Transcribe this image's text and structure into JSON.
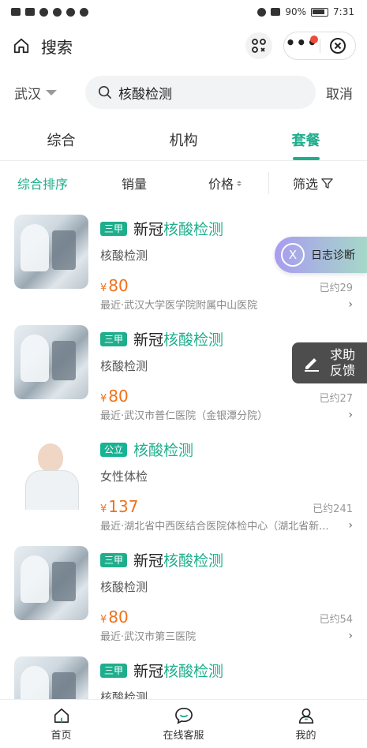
{
  "status_bar": {
    "battery": "90%",
    "time": "7:31"
  },
  "header": {
    "title": "搜索"
  },
  "search": {
    "city": "武汉",
    "query": "核酸检测",
    "cancel": "取消"
  },
  "tabs": [
    {
      "label": "综合",
      "active": false
    },
    {
      "label": "机构",
      "active": false
    },
    {
      "label": "套餐",
      "active": true
    }
  ],
  "filters": {
    "sort": "综合排序",
    "sales": "销量",
    "price": "价格",
    "filter": "筛选"
  },
  "items": [
    {
      "badge": "三甲",
      "title_prefix": "新冠",
      "title_hl": "核酸检测",
      "subtitle": "核酸检测",
      "yen": "¥",
      "price": "80",
      "sold": "已约29",
      "hospital": "最近·武汉大学医学院附属中山医院",
      "image": "lab"
    },
    {
      "badge": "三甲",
      "title_prefix": "新冠",
      "title_hl": "核酸检测",
      "subtitle": "核酸检测",
      "yen": "¥",
      "price": "80",
      "sold": "已约27",
      "hospital": "最近·武汉市普仁医院（金银潭分院）",
      "image": "lab"
    },
    {
      "badge": "公立",
      "title_prefix": "",
      "title_hl": "核酸检测",
      "subtitle": "女性体检",
      "yen": "¥",
      "price": "137",
      "sold": "已约241",
      "hospital": "最近·湖北省中西医结合医院体检中心（湖北省新...",
      "image": "doctor"
    },
    {
      "badge": "三甲",
      "title_prefix": "新冠",
      "title_hl": "核酸检测",
      "subtitle": "核酸检测",
      "yen": "¥",
      "price": "80",
      "sold": "已约54",
      "hospital": "最近·武汉市第三医院",
      "image": "lab"
    },
    {
      "badge": "三甲",
      "title_prefix": "新冠",
      "title_hl": "核酸检测",
      "subtitle": "核酸检测",
      "yen": "",
      "price": "",
      "sold": "",
      "hospital": "",
      "image": "lab"
    }
  ],
  "floating": {
    "diag_icon": "X",
    "diag_label": "日志诊断",
    "help_line1": "求助",
    "help_line2": "反馈"
  },
  "bottom_nav": [
    {
      "label": "首页",
      "icon": "home-icon"
    },
    {
      "label": "在线客服",
      "icon": "chat-icon"
    },
    {
      "label": "我的",
      "icon": "user-icon"
    }
  ],
  "colors": {
    "accent": "#1fae8c",
    "price": "#f0711b",
    "alert_dot": "#f04a3a"
  }
}
